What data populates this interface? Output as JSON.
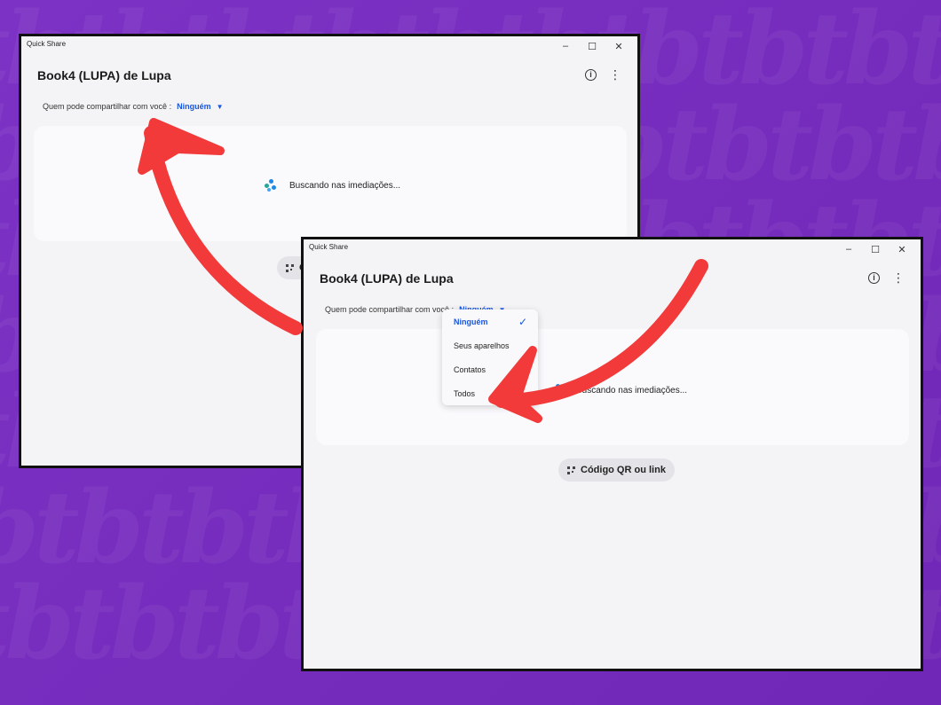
{
  "window1": {
    "app_title": "Quick Share",
    "device_name": "Book4 (LUPA) de Lupa",
    "share_label": "Quem pode compartilhar com você :",
    "share_value": "Ninguém",
    "scan_status": "Buscando nas imediações...",
    "qr_button": "C"
  },
  "window2": {
    "app_title": "Quick Share",
    "device_name": "Book4 (LUPA) de Lupa",
    "share_label": "Quem pode compartilhar com você :",
    "share_value": "Ninguém",
    "scan_status": "Buscando nas imediações...",
    "qr_button": "Código QR ou link",
    "dropdown": {
      "options": [
        "Ninguém",
        "Seus aparelhos",
        "Contatos",
        "Todos"
      ],
      "selected": "Ninguém"
    }
  },
  "window_controls": {
    "minimize": "–",
    "maximize": "☐",
    "close": "✕"
  },
  "colors": {
    "background": "#7a2fbf",
    "accent": "#1a56db",
    "arrow": "#f23a3a"
  },
  "icons": [
    "info-icon",
    "kebab-menu-icon",
    "spinner-icon",
    "qr-code-icon",
    "check-icon",
    "caret-down-icon"
  ]
}
